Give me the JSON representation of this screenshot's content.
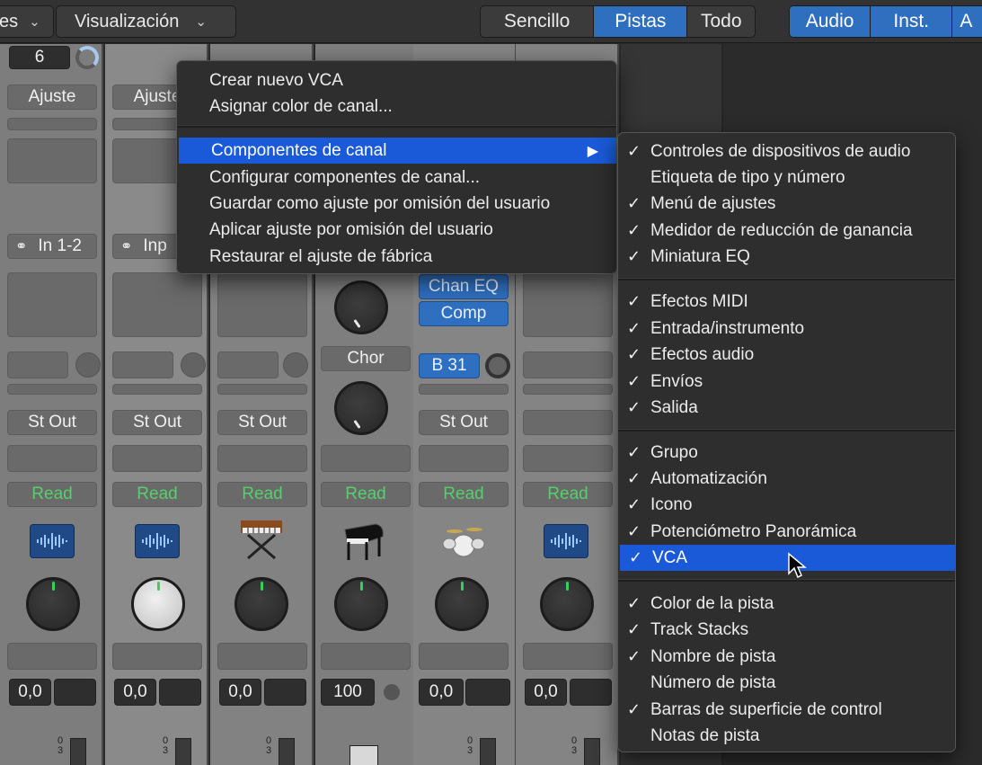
{
  "toolbar": {
    "left_partial": "es",
    "view_menu": "Visualización",
    "filter_tabs": [
      "Sencillo",
      "Pistas",
      "Todo"
    ],
    "type_tabs": [
      "Audio",
      "Inst.",
      "A"
    ]
  },
  "mixer": {
    "strip1_number": "6",
    "setting_label": "Ajuste",
    "setting_label_partial": "Ajuste",
    "input_label": "In 1-2",
    "input_label_partial": "Inp",
    "plugin_1": "Chan EQ",
    "plugin_2": "Comp",
    "send_label": "Chor",
    "bus_label": "B 31",
    "output_label": "St Out",
    "automation_label": "Read",
    "volume_value": "0,0",
    "aux_volume_value": "100",
    "scale_top": "0",
    "scale_second": "3"
  },
  "menu": {
    "items": [
      "Crear nuevo VCA",
      "Asignar color de canal...",
      "Componentes de canal",
      "Configurar componentes de canal...",
      "Guardar como ajuste por omisión del usuario",
      "Aplicar ajuste por omisión del usuario",
      "Restaurar el ajuste de fábrica"
    ],
    "submenu_arrow": "▶"
  },
  "submenu": {
    "check_glyph": "✓",
    "group1": [
      "Controles de dispositivos de audio",
      "Etiqueta de tipo y número",
      "Menú de ajustes",
      "Medidor de reducción de ganancia",
      "Miniatura EQ"
    ],
    "group2": [
      "Efectos MIDI",
      "Entrada/instrumento",
      "Efectos audio",
      "Envíos",
      "Salida"
    ],
    "group3": [
      "Grupo",
      "Automatización",
      "Icono",
      "Potenciómetro Panorámica",
      "VCA"
    ],
    "group4": [
      "Color de la pista",
      "Track Stacks",
      "Nombre de pista",
      "Número de pista",
      "Barras de superficie de control",
      "Notas de pista"
    ]
  },
  "colors": {
    "menu_highlight": "#1a5ad8",
    "tab_active": "#2f6fc0",
    "read_green": "#55d06a"
  },
  "icons": [
    "audio-waveform-icon",
    "synth-keyboard-icon",
    "grand-piano-icon",
    "drum-kit-icon",
    "link-rings-icon",
    "submenu-arrow-icon",
    "pointer-cursor-icon"
  ]
}
